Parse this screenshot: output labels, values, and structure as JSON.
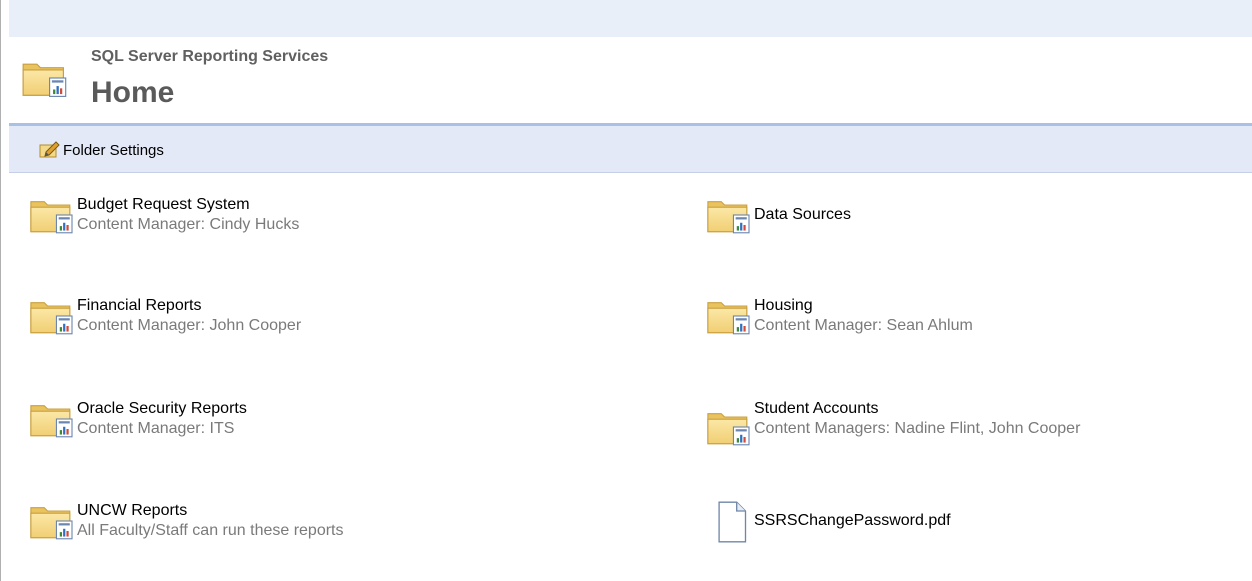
{
  "header": {
    "app_title": "SQL Server Reporting Services",
    "page_title": "Home"
  },
  "toolbar": {
    "folder_settings_label": "Folder Settings"
  },
  "items": [
    {
      "name": "Budget Request System",
      "description": "Content Manager: Cindy Hucks",
      "type": "folder"
    },
    {
      "name": "Data Sources",
      "description": "",
      "type": "folder"
    },
    {
      "name": "Financial Reports",
      "description": "Content Manager: John Cooper",
      "type": "folder"
    },
    {
      "name": "Housing",
      "description": "Content Manager: Sean Ahlum",
      "type": "folder"
    },
    {
      "name": "Oracle Security Reports",
      "description": "Content Manager: ITS",
      "type": "folder"
    },
    {
      "name": "Student Accounts",
      "description": "Content Managers: Nadine Flint, John Cooper",
      "type": "folder"
    },
    {
      "name": "UNCW Reports",
      "description": "All Faculty/Staff can run these reports",
      "type": "folder"
    },
    {
      "name": "SSRSChangePassword.pdf",
      "description": "",
      "type": "file"
    }
  ],
  "icons": {
    "folder": "report-folder-icon",
    "file": "document-icon",
    "settings": "folder-settings-icon"
  },
  "colors": {
    "top_band": "#e9eff8",
    "toolbar": "#e4e9f7",
    "header_rule": "#a9c1e3",
    "title": "#5a5a5a",
    "description": "#7a7a7a"
  }
}
